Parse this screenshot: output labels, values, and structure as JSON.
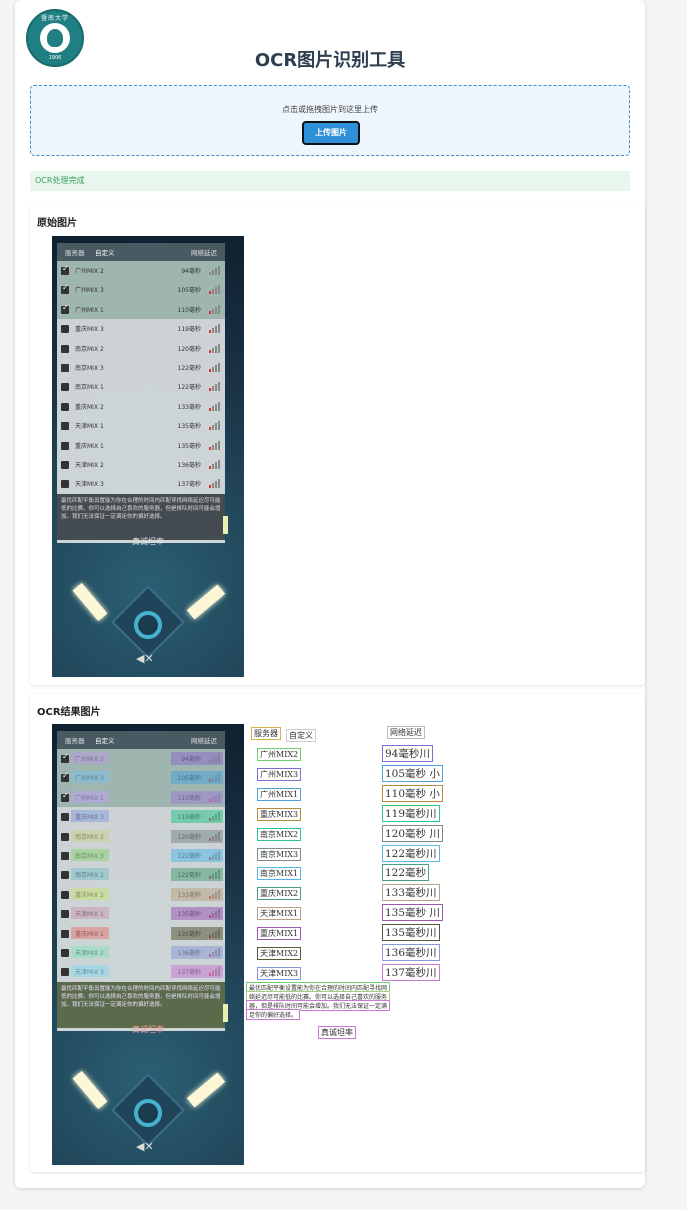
{
  "app": {
    "title": "OCR图片识别工具",
    "logo_text": "暨南大学",
    "logo_subtext": "JINAN UNIVERSITY",
    "logo_year": "1906"
  },
  "upload": {
    "hint": "点击或拖拽图片到这里上传",
    "button_label": "上传图片"
  },
  "status": {
    "message": "OCR处理完成"
  },
  "panels": {
    "original_title": "原始图片",
    "result_title": "OCR结果图片"
  },
  "screenshot": {
    "tab_server": "服务器",
    "tab_custom": "自定义",
    "tab_latency": "网络延迟",
    "rows": [
      {
        "name": "广州MIX 2",
        "ping": "94毫秒",
        "checked": true
      },
      {
        "name": "广州MIX 3",
        "ping": "105毫秒",
        "checked": true
      },
      {
        "name": "广州MIX 1",
        "ping": "110毫秒",
        "checked": true
      },
      {
        "name": "重庆MIX 3",
        "ping": "119毫秒",
        "checked": false
      },
      {
        "name": "南京MIX 2",
        "ping": "120毫秒",
        "checked": false
      },
      {
        "name": "南京MIX 3",
        "ping": "122毫秒",
        "checked": false
      },
      {
        "name": "南京MIX 1",
        "ping": "122毫秒",
        "checked": false
      },
      {
        "name": "重庆MIX 2",
        "ping": "133毫秒",
        "checked": false
      },
      {
        "name": "天津MIX 1",
        "ping": "135毫秒",
        "checked": false
      },
      {
        "name": "重庆MIX 1",
        "ping": "135毫秒",
        "checked": false
      },
      {
        "name": "天津MIX 2",
        "ping": "136毫秒",
        "checked": false
      },
      {
        "name": "天津MIX 3",
        "ping": "137毫秒",
        "checked": false
      }
    ],
    "description": "最优匹配平衡设置能为你在合理的时间内匹配寻找网络延迟尽可能低的比赛。你可以选择自己喜欢的服务器，但是排队时间可能会增加。我们无法保证一定满足你的偏好选择。",
    "mid_label": "真诚坦率",
    "mute_icon": "✕"
  },
  "ocr_results": {
    "header": [
      "服务器",
      "自定义",
      "网络延迟"
    ],
    "names": [
      "广州MIX2",
      "广州MIX3",
      "广州MIX1",
      "重庆MIX3",
      "南京MIX2",
      "南京MIX3",
      "南京MIX1",
      "重庆MIX2",
      "天津MIX1",
      "重庆MIX1",
      "天津MIX2",
      "天津MIX3"
    ],
    "pings": [
      "94毫秒川",
      "105毫秒 小",
      "110毫秒 小",
      "119毫秒川",
      "120毫秒 川",
      "122毫秒川",
      "122毫秒",
      "133毫秒川",
      "135毫秒 川",
      "135毫秒川",
      "136毫秒川",
      "137毫秒川"
    ],
    "desc_lines": [
      "最优匹配平衡设置能为你在合理的时间内匹配寻找网",
      "络延迟尽可能低的比赛。你可以选择自己喜欢的服务",
      "器，但是排队时间可能会增加。我们无法保证一定满",
      "足你的偏好选择。"
    ],
    "mid_label": "真诚坦率"
  },
  "colors": {
    "accent": "#2f8fd8",
    "status_bg": "#e8f7ee",
    "status_text": "#3a9d5d",
    "title": "#2c3e50"
  }
}
